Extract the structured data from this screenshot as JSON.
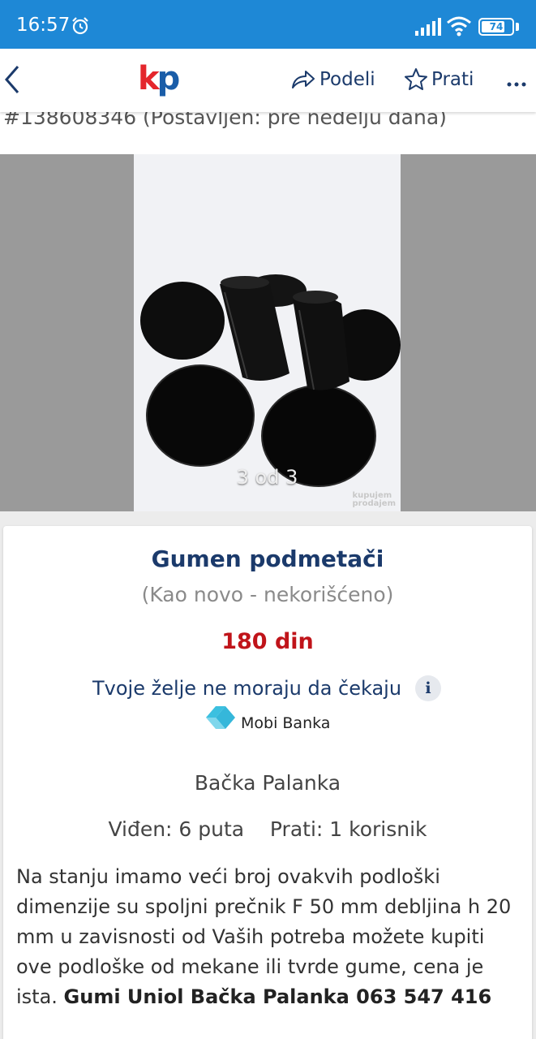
{
  "status_bar": {
    "time": "16:57",
    "battery": "74",
    "alarm_icon": "alarm-clock-icon",
    "signal_icon": "cellular-signal-icon",
    "wifi_icon": "wifi-icon"
  },
  "header": {
    "back_icon": "chevron-left-icon",
    "logo_k": "k",
    "logo_p": "p",
    "share_label": "Podeli",
    "follow_label": "Prati",
    "more_icon": "more-dots-icon",
    "colors": {
      "logo_red": "#e4262c",
      "logo_blue": "#1a5da8",
      "header_text": "#1b3a6b",
      "status_bar": "#1e88d6"
    }
  },
  "ad": {
    "id_line": "#138608346 (Postavljen: pre nedelju dana)"
  },
  "gallery": {
    "counter": "3 od 3",
    "watermark_line1": "kupujem",
    "watermark_line2": "prodajem"
  },
  "listing": {
    "title": "Gumen podmetači",
    "condition": "(Kao novo - nekorišćeno)",
    "price": "180 din",
    "price_color": "#c0141a",
    "promo_text": "Tvoje želje ne moraju da čekaju",
    "info_icon": "i",
    "mobi_banka": "Mobi Banka",
    "location": "Bačka Palanka",
    "views": "Viđen: 6 puta",
    "followers": "Prati: 1 korisnik",
    "description": "Na stanju imamo veći broj ovakvih podloški dimenzije su  spoljni prečnik  F 50 mm debljina h 20 mm u zavisnosti od Vaših potreba možete kupiti ove podloške  od mekane ili tvrde gume, cena je ista. ",
    "description_bold": "Gumi Uniol Bačka Palanka 063 547 416"
  }
}
